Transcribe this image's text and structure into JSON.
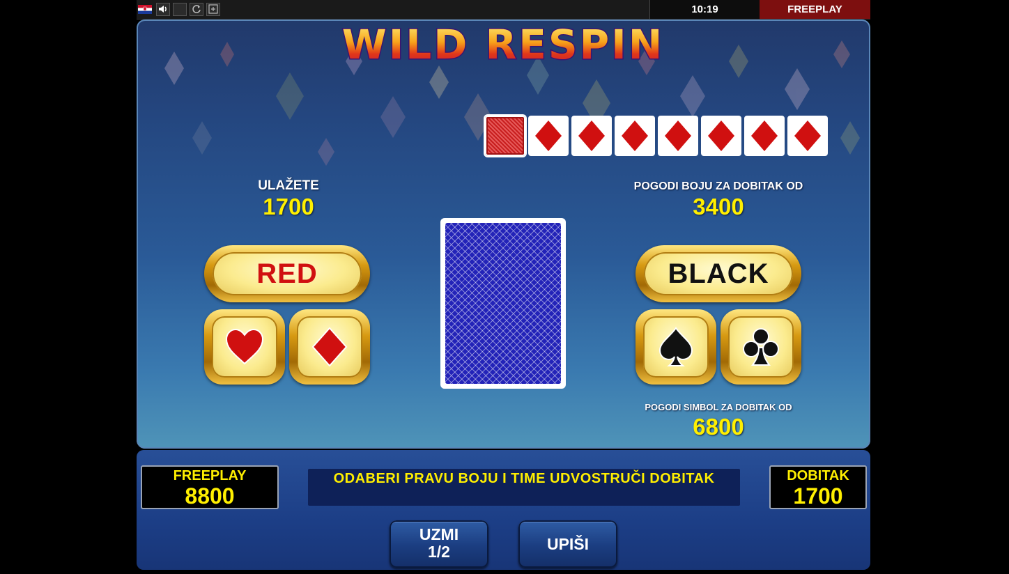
{
  "topbar": {
    "clock": "10:19",
    "mode": "FREEPLAY",
    "icons": [
      "flag-icon",
      "sound-icon",
      "fullscreen-icon",
      "reload-icon",
      "settings-icon"
    ]
  },
  "game": {
    "title": "WILD RESPIN",
    "history_cards": [
      "back",
      "diamond",
      "diamond",
      "diamond",
      "diamond",
      "diamond",
      "diamond",
      "diamond"
    ],
    "stake_label": "ULAŽETE",
    "stake_value": "1700",
    "color_win_label": "POGODI BOJU ZA DOBITAK OD",
    "color_win_value": "3400",
    "suit_win_label": "POGODI SIMBOL ZA DOBITAK OD",
    "suit_win_value": "6800",
    "red_label": "RED",
    "black_label": "BLACK",
    "suits": [
      "heart",
      "diamond",
      "spade",
      "club"
    ]
  },
  "bottom": {
    "credit_label": "FREEPLAY",
    "credit_value": "8800",
    "message": "ODABERI PRAVU BOJU I TIME UDVOSTRUČI DOBITAK",
    "win_label": "DOBITAK",
    "win_value": "1700",
    "take_label_1": "UZMI",
    "take_label_2": "1/2",
    "collect_label": "UPIŠI"
  },
  "colors": {
    "accent_yellow": "#ffef00",
    "suit_red": "#d01010",
    "freeplay_bg": "#7d0f0f"
  }
}
